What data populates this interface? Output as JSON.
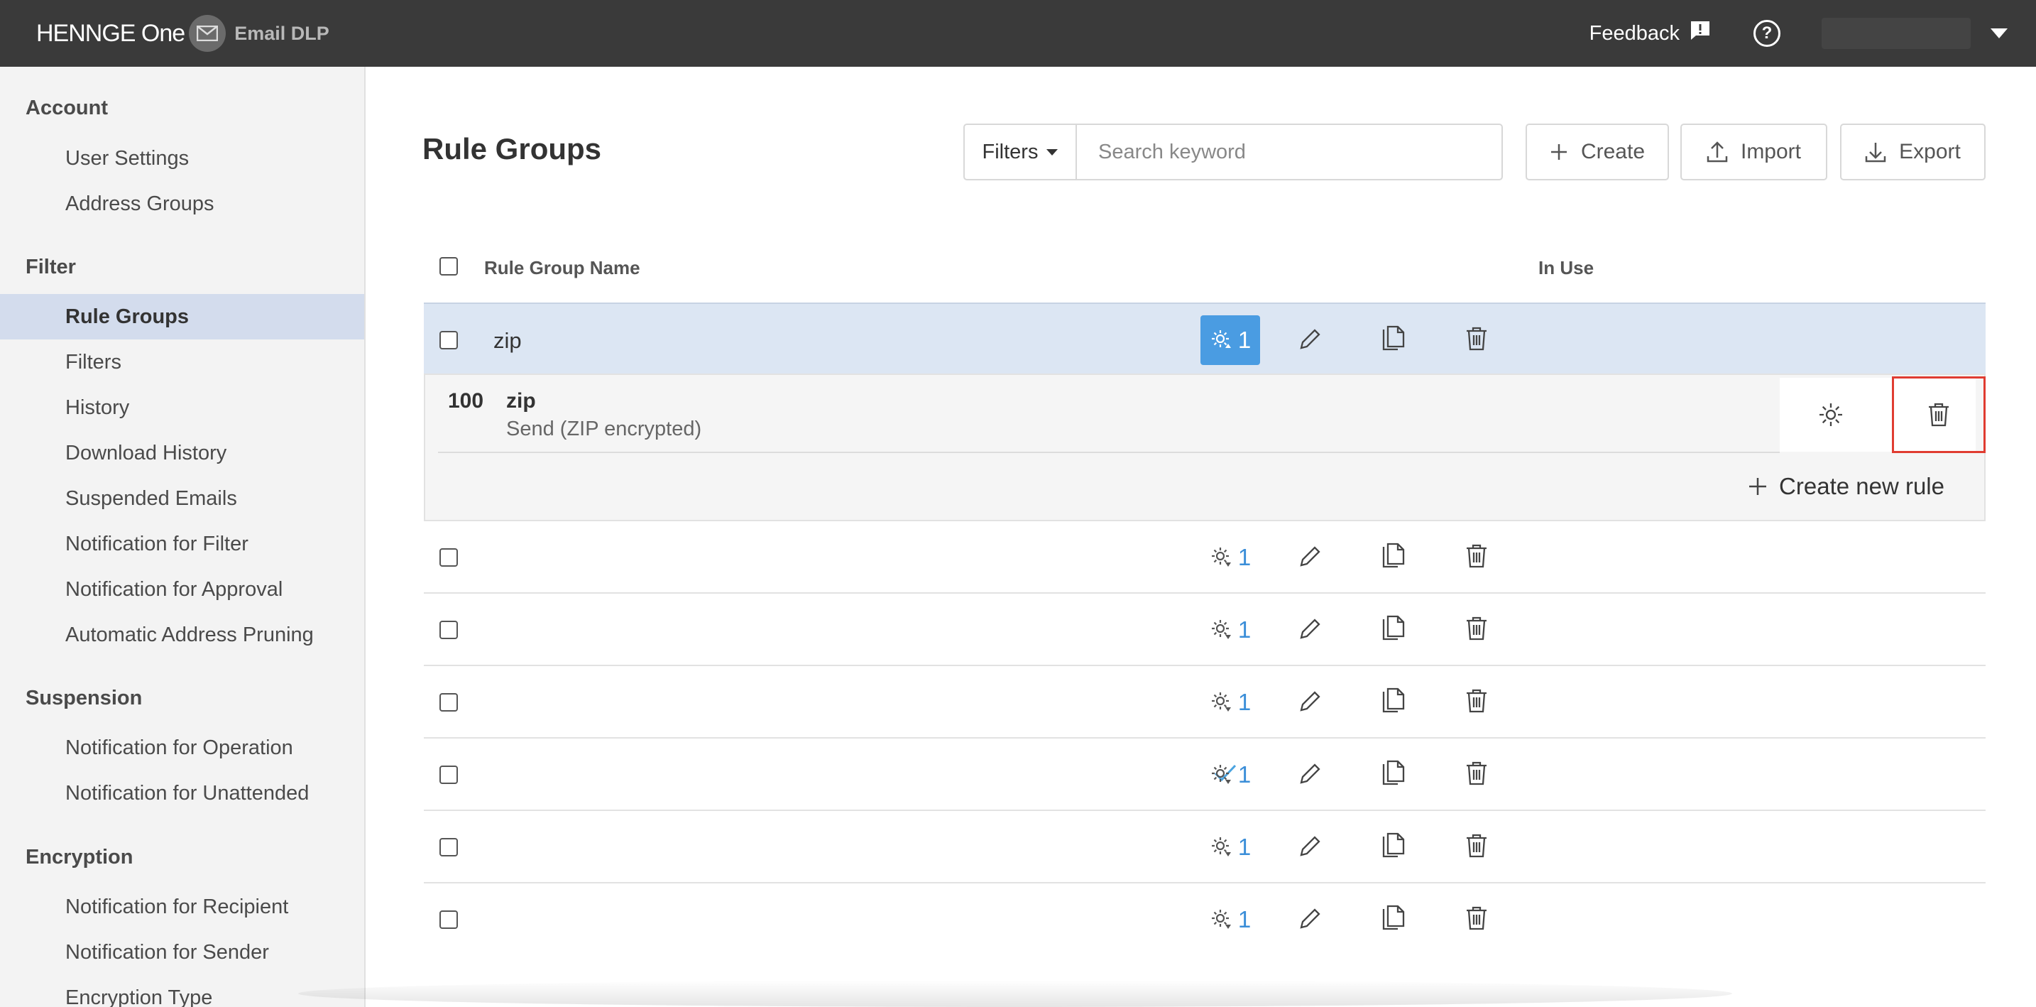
{
  "header": {
    "brand": "HENNGE One",
    "product": "Email DLP",
    "feedback_label": "Feedback",
    "help_label": "?"
  },
  "sidebar": {
    "sections": [
      {
        "title": "Account",
        "items": [
          "User Settings",
          "Address Groups"
        ]
      },
      {
        "title": "Filter",
        "items": [
          "Rule Groups",
          "Filters",
          "History",
          "Download History",
          "Suspended Emails",
          "Notification for Filter",
          "Notification for Approval",
          "Automatic Address Pruning"
        ]
      },
      {
        "title": "Suspension",
        "items": [
          "Notification for Operation",
          "Notification for Unattended"
        ]
      },
      {
        "title": "Encryption",
        "items": [
          "Notification for Recipient",
          "Notification for Sender",
          "Encryption Type"
        ]
      }
    ],
    "active_item": "Rule Groups"
  },
  "main": {
    "title": "Rule Groups",
    "filters_label": "Filters",
    "search_placeholder": "Search keyword",
    "create_label": "Create",
    "import_label": "Import",
    "export_label": "Export",
    "columns": {
      "name": "Rule Group Name",
      "in_use": "In Use"
    },
    "rows": [
      {
        "name": "zip",
        "in_use": true,
        "rule_count": "1",
        "expanded": true
      },
      {
        "name": "",
        "in_use": false,
        "rule_count": "1"
      },
      {
        "name": "",
        "in_use": false,
        "rule_count": "1"
      },
      {
        "name": "",
        "in_use": false,
        "rule_count": "1"
      },
      {
        "name": "",
        "in_use": true,
        "rule_count": "1"
      },
      {
        "name": "",
        "in_use": false,
        "rule_count": "1"
      },
      {
        "name": "",
        "in_use": false,
        "rule_count": "1"
      }
    ],
    "expanded_rule": {
      "priority": "100",
      "name": "zip",
      "action": "Send (ZIP encrypted)"
    },
    "create_rule_label": "Create new rule"
  },
  "colors": {
    "topbar": "#3a3a3a",
    "sidebar_active": "#d3dced",
    "selected_row": "#dce6f3",
    "accent": "#4a9ce2",
    "highlight": "#e03c31"
  }
}
